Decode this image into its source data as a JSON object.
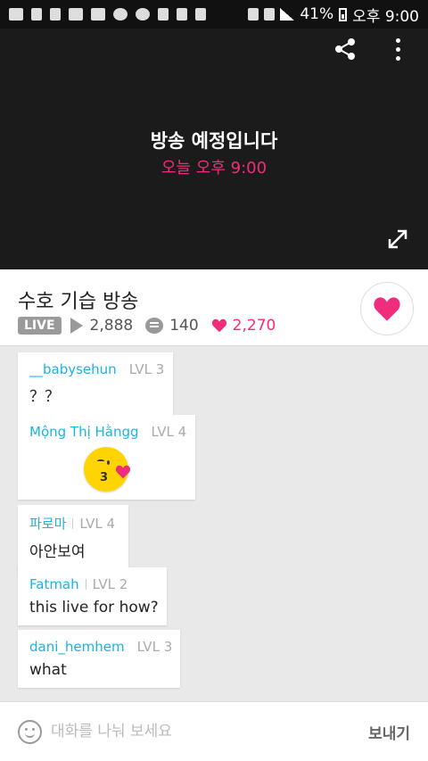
{
  "status_bar": {
    "left_icons": [
      "message-icon",
      "image-icon",
      "microphone-icon",
      "youtube-icon",
      "payco-icon",
      "coin-icon",
      "target-icon",
      "twitter-icon",
      "ok-icon",
      "heart-outline-icon"
    ],
    "battery": "41%",
    "time_label": "오후 9:00"
  },
  "player": {
    "schedule_title": "방송 예정입니다",
    "schedule_time": "오늘 오후 9:00"
  },
  "broadcast": {
    "title": "수호 기습 방송",
    "live_badge": "LIVE",
    "views": "2,888",
    "comments": "140",
    "likes": "2,270"
  },
  "chat": {
    "messages": [
      {
        "user": "__babysehun",
        "level": "LVL 3",
        "text": "？？"
      },
      {
        "user": "Mộng Thị Hằngg",
        "level": "LVL 4",
        "text": ""
      },
      {
        "user": "파로마",
        "level": "LVL 4",
        "text": "아안보여"
      },
      {
        "user": "Fatmah",
        "level": "LVL 2",
        "text": "this live for how?"
      },
      {
        "user": "dani_hemhem",
        "level": "LVL 3",
        "text": "what"
      }
    ],
    "sticker_mouth": "3"
  },
  "input": {
    "placeholder": "대화를 나눠 보세요",
    "send_label": "보내기"
  },
  "colors": {
    "accent_pink": "#f02d7d",
    "username_blue": "#1bb3e6"
  }
}
